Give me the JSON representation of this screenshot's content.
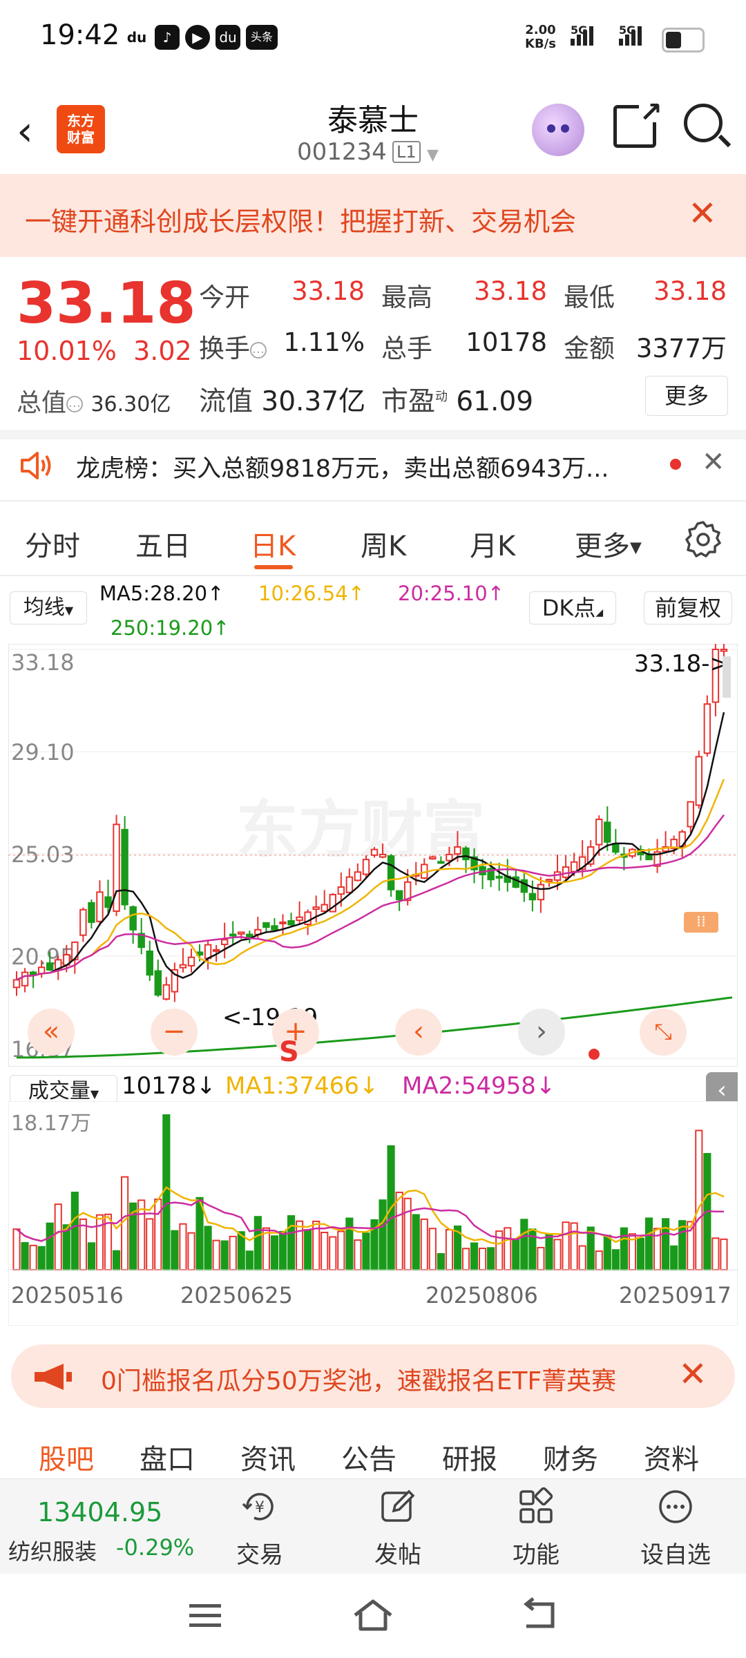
{
  "status_bar": {
    "time": "19:42",
    "net_speed": "2.00",
    "net_unit": "KB/s",
    "sim1": "5G",
    "sim2": "5G",
    "app_icons": [
      "du",
      "tiktok",
      "play",
      "du",
      "头条"
    ]
  },
  "header": {
    "title": "泰慕士",
    "code": "001234",
    "level": "L1",
    "logo_line1": "东方",
    "logo_line2": "财富"
  },
  "banner": {
    "text": "一键开通科创成长层权限！把握打新、交易机会"
  },
  "quote": {
    "price": "33.18",
    "change_pct": "10.01%",
    "change_abs": "3.02",
    "total_value_label": "总值",
    "total_value": "36.30亿",
    "open_label": "今开",
    "open": "33.18",
    "high_label": "最高",
    "high": "33.18",
    "low_label": "最低",
    "low": "33.18",
    "turnover_label": "换手",
    "turnover": "1.11%",
    "volume_label": "总手",
    "volume": "10178",
    "amount_label": "金额",
    "amount": "3377万",
    "float_label": "流值",
    "float_value": "30.37亿",
    "pe_label": "市盈",
    "pe_sup": "动",
    "pe": "61.09",
    "more": "更多"
  },
  "longhu": {
    "text": "龙虎榜：买入总额9818万元，卖出总额6943万..."
  },
  "ktabs": [
    "分时",
    "五日",
    "日K",
    "周K",
    "月K",
    "更多"
  ],
  "ma_legend": {
    "select": "均线",
    "ma5": "MA5:28.20",
    "ma10": "10:26.54",
    "ma20": "20:25.10",
    "ma250": "250:19.20",
    "dk": "DK点",
    "fq": "前复权"
  },
  "colors": {
    "up": "#e8332e",
    "down": "#1a9a1a",
    "ma5": "#111111",
    "ma10": "#f0b400",
    "ma20": "#cc2ba0",
    "ma250": "#1a9a1a",
    "accent": "#f05a21"
  },
  "chart_data": {
    "type": "candlestick",
    "y_ticks": [
      "33.18",
      "29.10",
      "25.03",
      "20.95",
      "16.87"
    ],
    "ylim": [
      16.87,
      33.18
    ],
    "last_price_label": "33.18->",
    "min_label": "<-19.19",
    "watermark": "东方财富",
    "volume": {
      "select": "成交量",
      "value": "10178",
      "ma1": "MA1:37466",
      "ma2": "MA2:54958",
      "max_label": "18.17万",
      "x_labels": [
        "20250516",
        "20250625",
        "20250806",
        "20250917"
      ]
    }
  },
  "ad": {
    "text": "0门槛报名瓜分50万奖池，速戳报名ETF菁英赛"
  },
  "sub_tabs": [
    "股吧",
    "盘口",
    "资讯",
    "公告",
    "研报",
    "财务",
    "资料"
  ],
  "bottom": {
    "index_value": "13404.95",
    "index_name": "纺织服装",
    "index_pct": "-0.29%",
    "trade": "交易",
    "post": "发帖",
    "func": "功能",
    "watch": "设自选"
  }
}
